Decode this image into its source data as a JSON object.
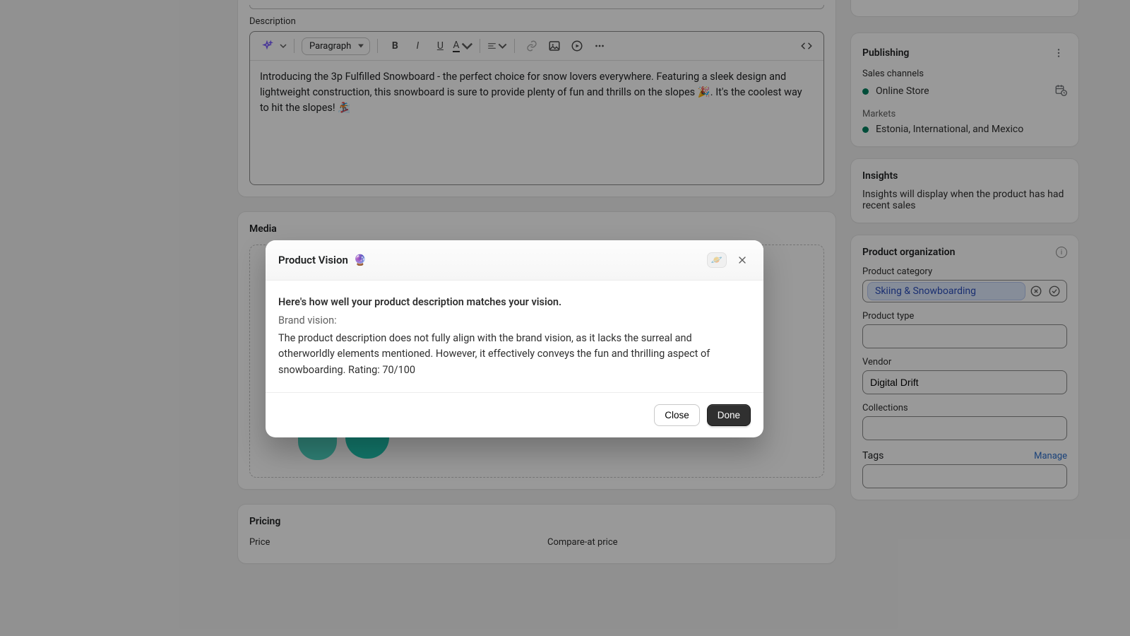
{
  "description": {
    "label": "Description",
    "style_select": "Paragraph",
    "body": "Introducing the 3p Fulfilled Snowboard - the perfect choice for snow lovers everywhere. Featuring a sleek design and lightweight construction, this snowboard is sure to provide plenty of fun and thrills on the slopes 🎉. It's the coolest way to hit the slopes! 🏂"
  },
  "media": {
    "title": "Media"
  },
  "pricing": {
    "title": "Pricing",
    "price_label": "Price",
    "compare_label": "Compare-at price"
  },
  "publishing": {
    "title": "Publishing",
    "channels_label": "Sales channels",
    "channel": "Online Store",
    "markets_label": "Markets",
    "markets_value": "Estonia, International, and Mexico"
  },
  "insights": {
    "title": "Insights",
    "text": "Insights will display when the product has had recent sales"
  },
  "org": {
    "title": "Product organization",
    "category_label": "Product category",
    "category_value": "Skiing & Snowboarding",
    "type_label": "Product type",
    "type_value": "",
    "vendor_label": "Vendor",
    "vendor_value": "Digital Drift",
    "collections_label": "Collections",
    "collections_value": "",
    "tags_label": "Tags",
    "manage_label": "Manage",
    "tags_value": ""
  },
  "modal": {
    "title": "Product Vision",
    "title_emoji": "🔮",
    "planet_emoji": "🪐",
    "lead": "Here's how well your product description matches your vision.",
    "sub": "Brand vision:",
    "body": "The product description does not fully align with the brand vision, as it lacks the surreal and otherworldly elements mentioned. However, it effectively conveys the fun and thrilling aspect of snowboarding. Rating: 70/100",
    "close_label": "Close",
    "done_label": "Done"
  }
}
